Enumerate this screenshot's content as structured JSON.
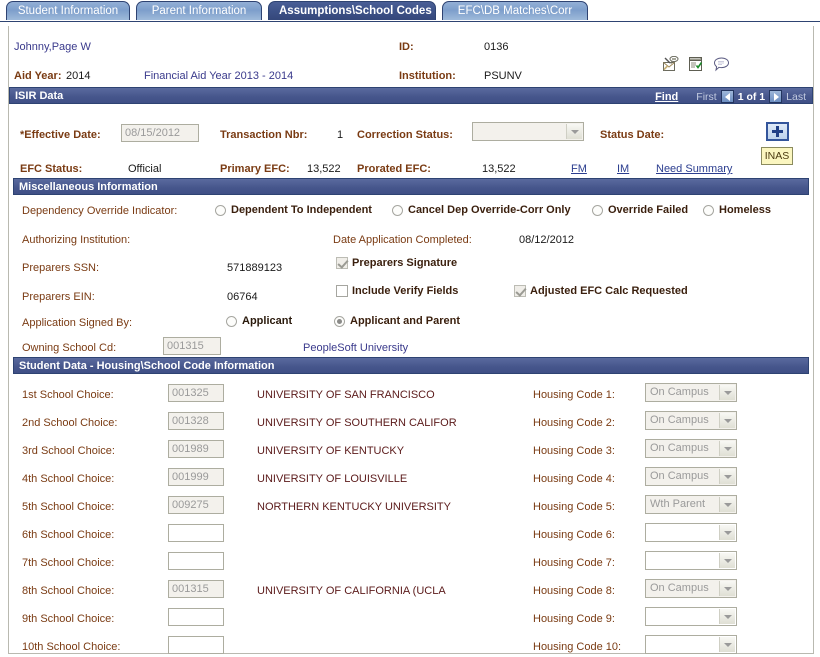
{
  "tabs": [
    {
      "label": "Student Information",
      "active": false
    },
    {
      "label": "Parent Information",
      "active": false
    },
    {
      "label": "Assumptions\\School Codes",
      "active": true
    },
    {
      "label": "EFC\\DB Matches\\Corr",
      "active": false
    }
  ],
  "header": {
    "student_name": "Johnny,Page W",
    "id_label": "ID:",
    "id_value": "0136",
    "aid_year_label": "Aid Year:",
    "aid_year_value": "2014",
    "aid_year_description": "Financial Aid Year 2013 - 2014",
    "institution_label": "Institution:",
    "institution_value": "PSUNV",
    "icons": [
      {
        "name": "notify-icon",
        "title": "Notify"
      },
      {
        "name": "checklist-icon",
        "title": "Checklist"
      },
      {
        "name": "comments-icon",
        "title": "Comments"
      }
    ]
  },
  "isir_section": {
    "title": "ISIR Data",
    "find_link": "Find",
    "first_label": "First",
    "page_count": "1 of 1",
    "last_label": "Last",
    "effective_date_label": "*Effective Date:",
    "effective_date_value": "08/15/2012",
    "transaction_nbr_label": "Transaction Nbr:",
    "transaction_nbr_value": "1",
    "correction_status_label": "Correction Status:",
    "correction_status_value": "",
    "status_date_label": "Status Date:",
    "status_date_value": "",
    "efc_status_label": "EFC Status:",
    "efc_status_value": "Official",
    "primary_efc_label": "Primary EFC:",
    "primary_efc_value": "13,522",
    "prorated_efc_label": "Prorated EFC:",
    "prorated_efc_value": "13,522",
    "fm_link": "FM",
    "im_link": "IM",
    "need_summary_link": "Need Summary",
    "add_button_label": "+",
    "inas_button_label": "INAS"
  },
  "misc_section": {
    "title": "Miscellaneous Information",
    "dependency_override_label": "Dependency Override Indicator:",
    "dependency_options": [
      {
        "label": "Dependent To Independent",
        "checked": false
      },
      {
        "label": "Cancel Dep Override-Corr Only",
        "checked": false
      },
      {
        "label": "Override Failed",
        "checked": false
      },
      {
        "label": "Homeless",
        "checked": false
      }
    ],
    "authorizing_institution_label": "Authorizing Institution:",
    "authorizing_institution_value": "",
    "date_application_completed_label": "Date Application Completed:",
    "date_application_completed_value": "08/12/2012",
    "preparers_ssn_label": "Preparers SSN:",
    "preparers_ssn_value": "571889123",
    "preparers_ein_label": "Preparers EIN:",
    "preparers_ein_value": "06764",
    "preparers_signature_label": "Preparers Signature",
    "preparers_signature_checked": true,
    "include_verify_fields_label": "Include Verify Fields",
    "include_verify_fields_checked": false,
    "adjusted_efc_label": "Adjusted EFC Calc Requested",
    "adjusted_efc_checked": true,
    "application_signed_by_label": "Application Signed By:",
    "signed_by_options": [
      {
        "label": "Applicant",
        "checked": false
      },
      {
        "label": "Applicant and Parent",
        "checked": true
      }
    ],
    "owning_school_cd_label": "Owning School Cd:",
    "owning_school_cd_value": "001315",
    "owning_school_name": "PeopleSoft University"
  },
  "school_section": {
    "title": "Student Data - Housing\\School Code Information",
    "rows": [
      {
        "choice_label": "1st School Choice:",
        "code": "001325",
        "school": "UNIVERSITY OF SAN FRANCISCO",
        "housing_label": "Housing Code 1:",
        "housing_value": "On Campus"
      },
      {
        "choice_label": "2nd School Choice:",
        "code": "001328",
        "school": "UNIVERSITY OF SOUTHERN CALIFOR",
        "housing_label": "Housing Code 2:",
        "housing_value": "On Campus"
      },
      {
        "choice_label": "3rd School Choice:",
        "code": "001989",
        "school": "UNIVERSITY OF KENTUCKY",
        "housing_label": "Housing Code 3:",
        "housing_value": "On Campus"
      },
      {
        "choice_label": "4th School Choice:",
        "code": "001999",
        "school": "UNIVERSITY OF LOUISVILLE",
        "housing_label": "Housing Code 4:",
        "housing_value": "On Campus"
      },
      {
        "choice_label": "5th School Choice:",
        "code": "009275",
        "school": "NORTHERN KENTUCKY UNIVERSITY",
        "housing_label": "Housing Code 5:",
        "housing_value": "Wth Parent"
      },
      {
        "choice_label": "6th School Choice:",
        "code": "",
        "school": "",
        "housing_label": "Housing Code 6:",
        "housing_value": ""
      },
      {
        "choice_label": "7th School Choice:",
        "code": "",
        "school": "",
        "housing_label": "Housing Code 7:",
        "housing_value": ""
      },
      {
        "choice_label": "8th School Choice:",
        "code": "001315",
        "school": "UNIVERSITY OF CALIFORNIA (UCLA",
        "housing_label": "Housing Code 8:",
        "housing_value": "On Campus"
      },
      {
        "choice_label": "9th School Choice:",
        "code": "",
        "school": "",
        "housing_label": "Housing Code 9:",
        "housing_value": ""
      },
      {
        "choice_label": "10th School Choice:",
        "code": "",
        "school": "",
        "housing_label": "Housing Code 10:",
        "housing_value": ""
      }
    ]
  },
  "colors": {
    "tab_active": "#3d5288",
    "tab_inactive": "#7d9ecb",
    "group_bar": "#47578d",
    "label_brown": "#7a3b13",
    "link_blue": "#2b3d8f",
    "inas_yellow": "#fbf6c0"
  }
}
